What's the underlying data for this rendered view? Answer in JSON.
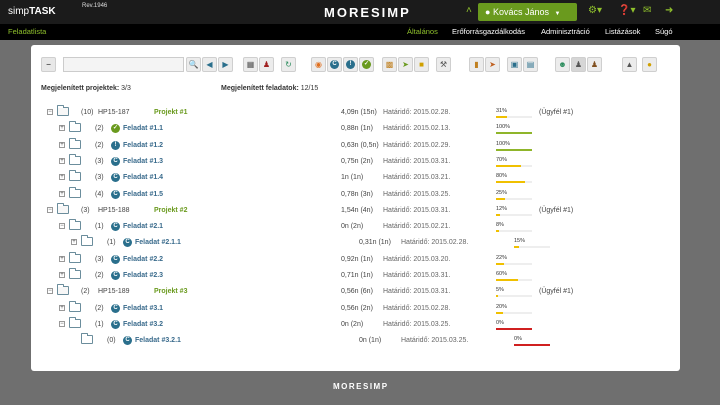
{
  "topbar": {
    "app_name_light": "simp",
    "app_name_bold": "TASK",
    "rev": "Rev.1946",
    "brand": "MORESIMP",
    "user": "Kovács János",
    "icons": [
      "chevron-up-icon",
      "user-icon",
      "gear-icon",
      "help-icon",
      "mail-icon",
      "logout-icon"
    ]
  },
  "navbar": {
    "left": "Feladatlista",
    "items": [
      "Általános",
      "Erőforrásgazdálkodás",
      "Adminisztráció",
      "Listázások",
      "Súgó"
    ],
    "active": "Általános"
  },
  "search": {
    "value": ""
  },
  "stats": {
    "projects_label": "Megjelenített projektek:",
    "projects_value": "3/3",
    "tasks_label": "Megjelenített feladatok:",
    "tasks_value": "12/15"
  },
  "status_colors": {
    "ok": "#6a9a1e",
    "warn": "#2a6f8c",
    "progress": "#2a6f8c"
  },
  "rows": [
    {
      "kind": "project",
      "count": "(10)",
      "code": "HP15-187",
      "name": "Projekt #1",
      "time": "4,09n (15n)",
      "due": "Határidő: 2015.02.28.",
      "pct": "31%",
      "pct_value": 31,
      "bar_color": "#f0c000",
      "client": "(Ügyfél #1)"
    },
    {
      "kind": "task",
      "count": "(2)",
      "status": "ok",
      "name": "Feladat #1.1",
      "time": "0,88n (1n)",
      "due": "Határidő: 2015.02.13.",
      "pct": "100%",
      "pct_value": 100,
      "bar_color": "#8fb52a"
    },
    {
      "kind": "task",
      "count": "(2)",
      "status": "warn",
      "name": "Feladat #1.2",
      "time": "0,63n (0,5n)",
      "due": "Határidő: 2015.02.29.",
      "pct": "100%",
      "pct_value": 100,
      "bar_color": "#8fb52a"
    },
    {
      "kind": "task",
      "count": "(3)",
      "status": "progress",
      "name": "Feladat #1.3",
      "time": "0,75n (2n)",
      "due": "Határidő: 2015.03.31.",
      "pct": "70%",
      "pct_value": 70,
      "bar_color": "#f0c000"
    },
    {
      "kind": "task",
      "count": "(3)",
      "status": "progress",
      "name": "Feladat #1.4",
      "time": "1n (1n)",
      "due": "Határidő: 2015.03.21.",
      "pct": "80%",
      "pct_value": 80,
      "bar_color": "#f0c000"
    },
    {
      "kind": "task",
      "count": "(4)",
      "status": "progress",
      "name": "Feladat #1.5",
      "time": "0,78n (3n)",
      "due": "Határidő: 2015.03.25.",
      "pct": "25%",
      "pct_value": 25,
      "bar_color": "#f0c000"
    },
    {
      "kind": "project",
      "count": "(3)",
      "code": "HP15-188",
      "name": "Projekt #2",
      "time": "1,54n (4n)",
      "due": "Határidő: 2015.03.31.",
      "pct": "12%",
      "pct_value": 12,
      "bar_color": "#f0c000",
      "client": "(Ügyfél #1)"
    },
    {
      "kind": "task",
      "count": "(1)",
      "status": "progress",
      "name": "Feladat #2.1",
      "time": "0n (2n)",
      "due": "Határidő: 2015.02.21.",
      "pct": "8%",
      "pct_value": 8,
      "bar_color": "#f0c000"
    },
    {
      "kind": "subtask",
      "count": "(1)",
      "status": "progress",
      "name": "Feladat #2.1.1",
      "time": "0,31n (1n)",
      "due": "Határidő: 2015.02.28.",
      "pct": "15%",
      "pct_value": 15,
      "bar_color": "#f0c000"
    },
    {
      "kind": "task",
      "count": "(3)",
      "status": "progress",
      "name": "Feladat #2.2",
      "time": "0,92n (1n)",
      "due": "Határidő: 2015.03.20.",
      "pct": "22%",
      "pct_value": 22,
      "bar_color": "#f0c000"
    },
    {
      "kind": "task",
      "count": "(2)",
      "status": "progress",
      "name": "Feladat #2.3",
      "time": "0,71n (1n)",
      "due": "Határidő: 2015.03.31.",
      "pct": "60%",
      "pct_value": 60,
      "bar_color": "#f0c000"
    },
    {
      "kind": "project",
      "count": "(2)",
      "code": "HP15-189",
      "name": "Projekt #3",
      "time": "0,56n (6n)",
      "due": "Határidő: 2015.03.31.",
      "pct": "5%",
      "pct_value": 5,
      "bar_color": "#f0c000",
      "client": "(Ügyfél #1)"
    },
    {
      "kind": "task",
      "count": "(2)",
      "status": "progress",
      "name": "Feladat #3.1",
      "time": "0,56n (2n)",
      "due": "Határidő: 2015.02.28.",
      "pct": "20%",
      "pct_value": 20,
      "bar_color": "#f0c000"
    },
    {
      "kind": "task",
      "count": "(1)",
      "status": "progress",
      "name": "Feladat #3.2",
      "time": "0n (2n)",
      "due": "Határidő: 2015.03.25.",
      "pct": "0%",
      "pct_value": 0,
      "bar_color": "#d02020"
    },
    {
      "kind": "subtask",
      "count": "(0)",
      "status": "progress",
      "name": "Feladat #3.2.1",
      "time": "0n (1n)",
      "due": "Határidő: 2015.03.25.",
      "pct": "0%",
      "pct_value": 0,
      "bar_color": "#d02020"
    }
  ],
  "footer": {
    "brand": "MORESIMP"
  }
}
